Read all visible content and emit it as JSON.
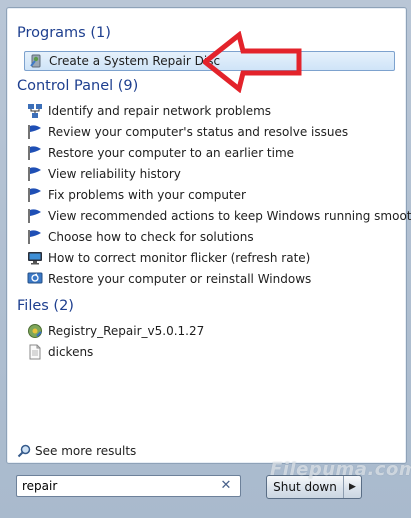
{
  "groups": {
    "programs": {
      "header": "Programs (1)",
      "items": [
        {
          "label": "Create a System Repair Disc",
          "icon": "repair-disc-icon"
        }
      ]
    },
    "control_panel": {
      "header": "Control Panel (9)",
      "items": [
        {
          "label": "Identify and repair network problems",
          "icon": "network-icon"
        },
        {
          "label": "Review your computer's status and resolve issues",
          "icon": "action-center-flag-icon"
        },
        {
          "label": "Restore your computer to an earlier time",
          "icon": "action-center-flag-icon"
        },
        {
          "label": "View reliability history",
          "icon": "action-center-flag-icon"
        },
        {
          "label": "Fix problems with your computer",
          "icon": "action-center-flag-icon"
        },
        {
          "label": "View recommended actions to keep Windows running smoothly",
          "icon": "action-center-flag-icon"
        },
        {
          "label": "Choose how to check for solutions",
          "icon": "action-center-flag-icon"
        },
        {
          "label": "How to correct monitor flicker (refresh rate)",
          "icon": "display-icon"
        },
        {
          "label": "Restore your computer or reinstall Windows",
          "icon": "recovery-icon"
        }
      ]
    },
    "files": {
      "header": "Files (2)",
      "items": [
        {
          "label": "Registry_Repair_v5.0.1.27",
          "icon": "installer-icon"
        },
        {
          "label": "dickens",
          "icon": "document-icon"
        }
      ]
    }
  },
  "see_more": "See more results",
  "search": {
    "value": "repair"
  },
  "shutdown": {
    "label": "Shut down"
  },
  "watermark": "Filepuma.com",
  "colors": {
    "header": "#1e3f8f",
    "arrow": "#e3232b",
    "flag": "#1f4fb5"
  }
}
